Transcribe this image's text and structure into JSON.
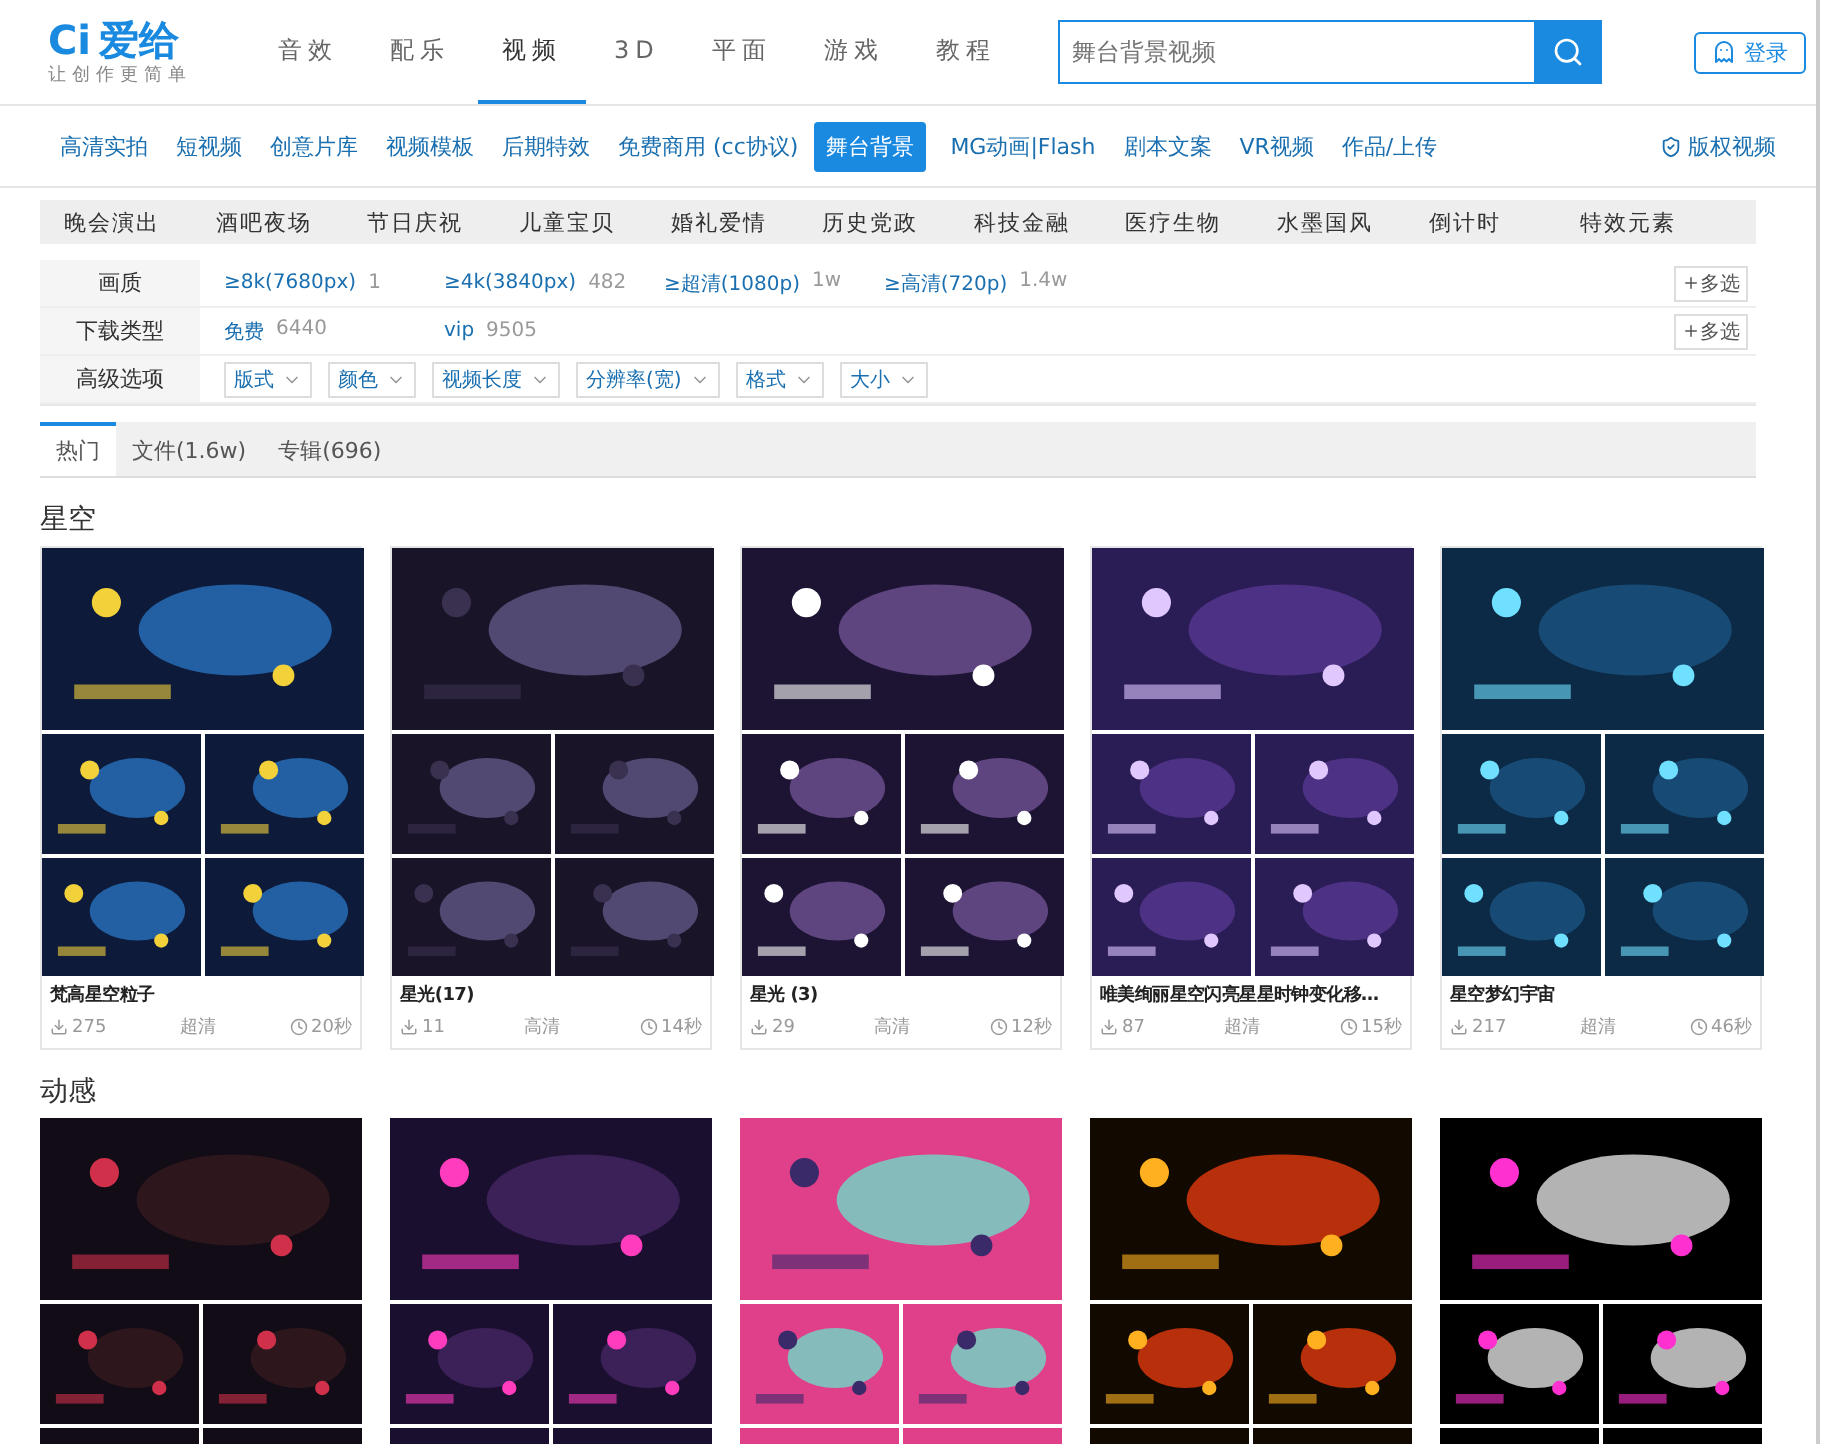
{
  "logo": {
    "name": "爱给",
    "mark": "Ci",
    "slogan": "让创作更简单"
  },
  "main_nav": [
    {
      "label": "音效",
      "selected": false
    },
    {
      "label": "配乐",
      "selected": false
    },
    {
      "label": "视频",
      "selected": true
    },
    {
      "label": "3D",
      "selected": false
    },
    {
      "label": "平面",
      "selected": false
    },
    {
      "label": "游戏",
      "selected": false
    },
    {
      "label": "教程",
      "selected": false
    }
  ],
  "search": {
    "placeholder": "舞台背景视频"
  },
  "login": "登录",
  "sub_nav": [
    {
      "label": "高清实拍",
      "selected": false
    },
    {
      "label": "短视频",
      "selected": false
    },
    {
      "label": "创意片库",
      "selected": false
    },
    {
      "label": "视频模板",
      "selected": false
    },
    {
      "label": "后期特效",
      "selected": false
    },
    {
      "label": "免费商用 (cc协议)",
      "selected": false
    },
    {
      "label": "舞台背景",
      "selected": true
    },
    {
      "label": "MG动画|Flash",
      "selected": false
    },
    {
      "label": "剧本文案",
      "selected": false
    },
    {
      "label": "VR视频",
      "selected": false
    },
    {
      "label": "作品/上传",
      "selected": false
    }
  ],
  "copyright_link": "版权视频",
  "categories": [
    "晚会演出",
    "酒吧夜场",
    "节日庆祝",
    "儿童宝贝",
    "婚礼爱情",
    "历史党政",
    "科技金融",
    "医疗生物",
    "水墨国风",
    "倒计时",
    "特效元素"
  ],
  "filters": [
    {
      "label": "画质",
      "kind": "options",
      "options": [
        {
          "text": "≥8k(7680px)",
          "count": "1"
        },
        {
          "text": "≥4k(3840px)",
          "count": "482"
        },
        {
          "text": "≥超清(1080p)",
          "count": "1w"
        },
        {
          "text": "≥高清(720p)",
          "count": "1.4w"
        }
      ],
      "multi": "多选"
    },
    {
      "label": "下载类型",
      "kind": "options",
      "options": [
        {
          "text": "免费",
          "count": "6440"
        },
        {
          "text": "vip",
          "count": "9505"
        }
      ],
      "multi": "多选"
    },
    {
      "label": "高级选项",
      "kind": "dropdowns",
      "dropdowns": [
        "版式",
        "颜色",
        "视频长度",
        "分辨率(宽)",
        "格式",
        "大小"
      ]
    }
  ],
  "result_tabs": [
    {
      "label": "热门",
      "selected": true
    },
    {
      "label": "文件(1.6w)",
      "selected": false
    },
    {
      "label": "专辑(696)",
      "selected": false
    }
  ],
  "sections": [
    {
      "title": "星空",
      "cards": [
        {
          "title": "梵高星空粒子",
          "downloads": "275",
          "quality": "超清",
          "duration": "20秒"
        },
        {
          "title": "星光(17)",
          "downloads": "11",
          "quality": "高清",
          "duration": "14秒"
        },
        {
          "title": "星光 (3)",
          "downloads": "29",
          "quality": "高清",
          "duration": "12秒"
        },
        {
          "title": "唯美绚丽星空闪亮星星时钟变化移…",
          "downloads": "87",
          "quality": "超清",
          "duration": "15秒"
        },
        {
          "title": "星空梦幻宇宙",
          "downloads": "217",
          "quality": "超清",
          "duration": "46秒"
        }
      ]
    },
    {
      "title": "动感"
    }
  ]
}
